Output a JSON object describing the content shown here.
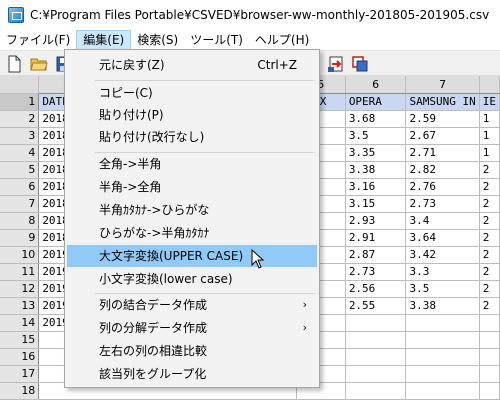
{
  "window": {
    "title": "C:¥Program Files Portable¥CSVED¥browser-ww-monthly-201805-201905.csv"
  },
  "menubar": {
    "items": [
      {
        "label": "ファイル(F)"
      },
      {
        "label": "編集(E)"
      },
      {
        "label": "検索(S)"
      },
      {
        "label": "ツール(T)"
      },
      {
        "label": "ヘルプ(H)"
      }
    ]
  },
  "toolbar": {
    "icons": [
      "new-file-icon",
      "open-folder-icon",
      "save-icon",
      "merge-columns-icon",
      "copy-window-icon"
    ]
  },
  "grid": {
    "visible_col_headers": [
      "5",
      "6",
      "7",
      ""
    ],
    "row_numbers": [
      "1",
      "2",
      "3",
      "4",
      "5",
      "6",
      "7",
      "8",
      "9",
      "10",
      "11",
      "12",
      "13",
      "14",
      "15",
      "16",
      "17",
      "18",
      "19"
    ],
    "col1_visible": [
      "DATE",
      "2018",
      "2018",
      "2018",
      "2018",
      "2018",
      "2018",
      "2018",
      "2018",
      "2019",
      "2019",
      "2019",
      "2019",
      "2019",
      "",
      "",
      "",
      "",
      ""
    ],
    "rows": [
      [
        "EFOX",
        "OPERA",
        "SAMSUNG IN",
        "IE"
      ],
      [
        "7",
        "3.68",
        "2.59",
        "1"
      ],
      [
        "7",
        "3.5",
        "2.67",
        "1"
      ],
      [
        "2",
        "3.35",
        "2.71",
        "1"
      ],
      [
        "",
        "3.38",
        "2.82",
        "2"
      ],
      [
        "1",
        "3.16",
        "2.76",
        "2"
      ],
      [
        "2",
        "3.15",
        "2.73",
        "2"
      ],
      [
        "3",
        "2.93",
        "3.4",
        "2"
      ],
      [
        "6",
        "2.91",
        "3.64",
        "2"
      ],
      [
        "9",
        "2.87",
        "3.42",
        "2"
      ],
      [
        "2",
        "2.73",
        "3.3",
        "2"
      ],
      [
        "3",
        "2.56",
        "3.5",
        "2"
      ],
      [
        "7",
        "2.55",
        "3.38",
        "2"
      ],
      [
        "",
        "",
        "",
        ""
      ],
      [
        "",
        "",
        "",
        ""
      ],
      [
        "",
        "",
        "",
        ""
      ],
      [
        "",
        "",
        "",
        ""
      ],
      [
        "",
        "",
        "",
        ""
      ],
      [
        "",
        "",
        "",
        ""
      ]
    ]
  },
  "edit_menu": {
    "undo": {
      "label": "元に戻す(Z)",
      "shortcut": "Ctrl+Z"
    },
    "copy": {
      "label": "コピー(C)"
    },
    "paste": {
      "label": "貼り付け(P)"
    },
    "paste_no_newline": {
      "label": "貼り付け(改行なし)"
    },
    "zen_to_han": {
      "label": "全角->半角"
    },
    "han_to_zen": {
      "label": "半角->全角"
    },
    "hankana_to_hira": {
      "label": "半角ｶﾀｶﾅ->ひらがな"
    },
    "hira_to_hankana": {
      "label": "ひらがな->半角ｶﾀｶﾅ"
    },
    "upper_case": {
      "label": "大文字変換(UPPER CASE)"
    },
    "lower_case": {
      "label": "小文字変換(lower case)"
    },
    "join_columns": {
      "label": "列の結合データ作成",
      "arrow": "›"
    },
    "split_columns": {
      "label": "列の分解データ作成",
      "arrow": "›"
    },
    "compare_columns": {
      "label": "左右の列の相違比較"
    },
    "group_columns": {
      "label": "該当列をグループ化"
    }
  }
}
